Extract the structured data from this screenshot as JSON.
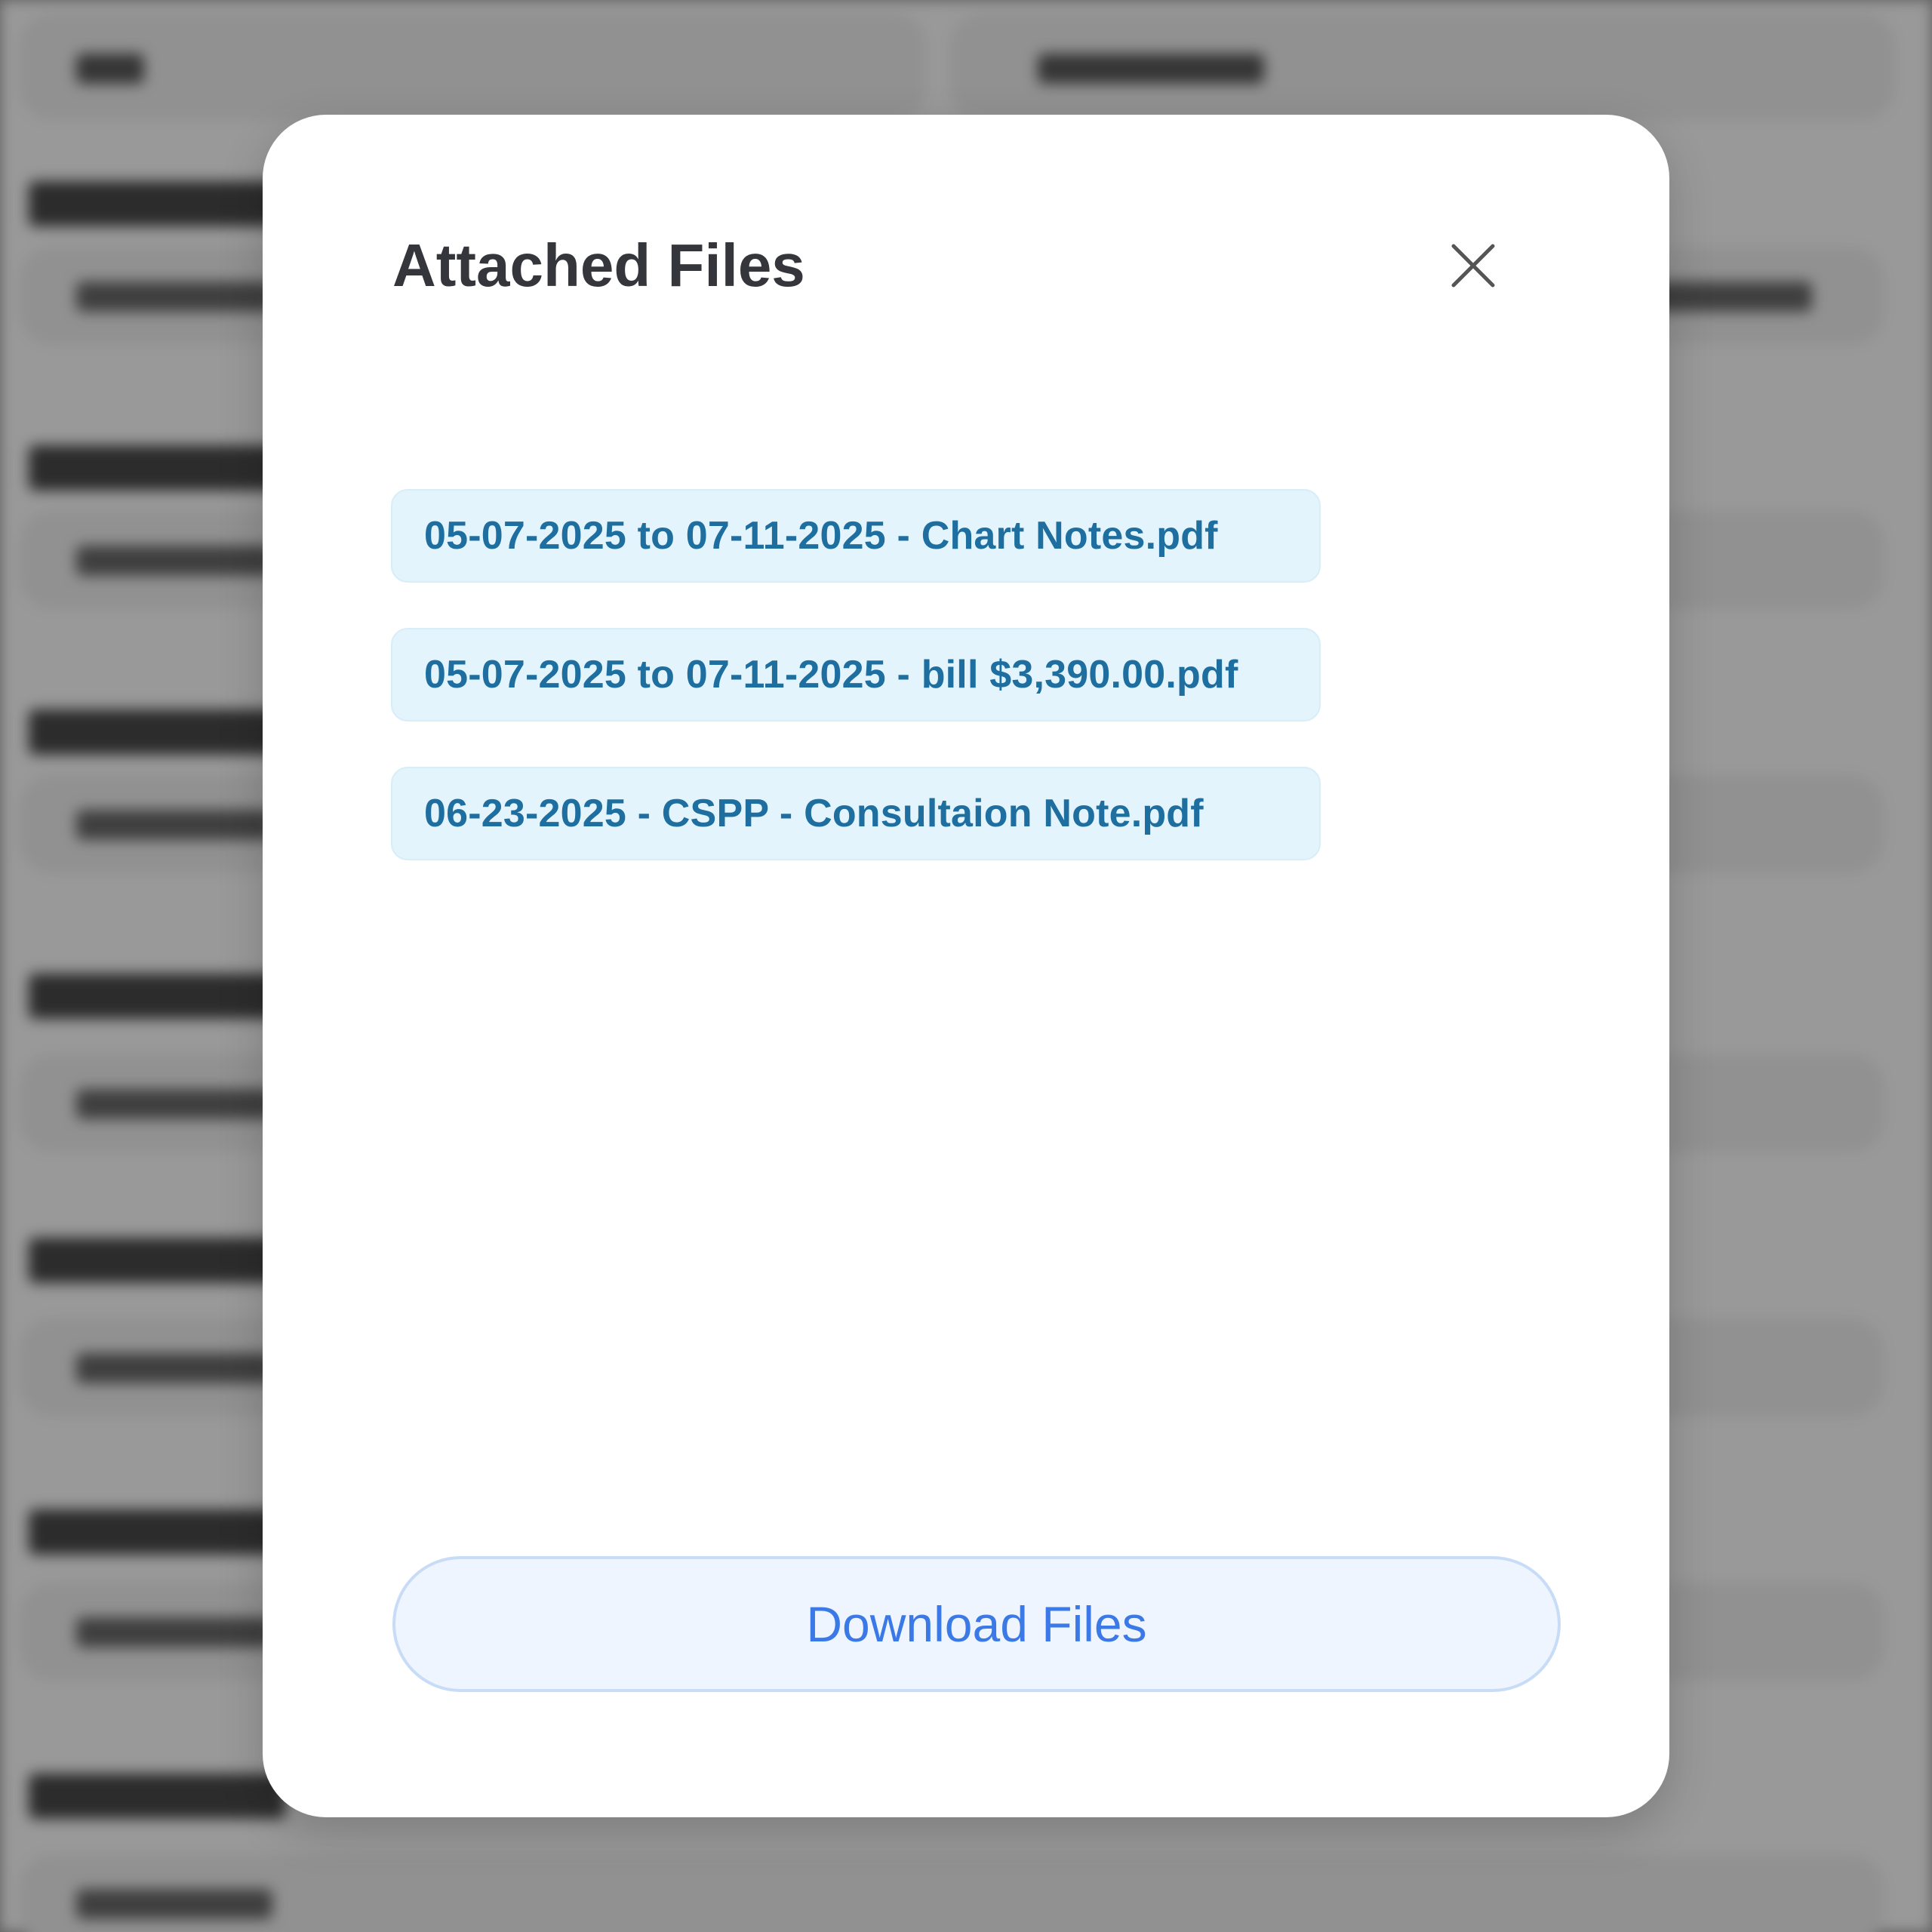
{
  "modal": {
    "title": "Attached Files",
    "close_icon": "close-icon",
    "files": [
      {
        "name": "05-07-2025 to 07-11-2025 -  Chart Notes.pdf"
      },
      {
        "name": "05-07-2025 to 07-11-2025 -  bill $3,390.00.pdf"
      },
      {
        "name": "06-23-2025 - CSPP - Consultaion Note.pdf"
      }
    ],
    "download_label": "Download Files"
  },
  "colors": {
    "title": "#35363b",
    "file_chip_bg": "#e3f4fc",
    "file_text": "#1e6fa0",
    "download_bg": "#eef5fe",
    "download_border": "#c8dcf7",
    "download_text": "#3b7ae6",
    "scrim": "rgba(0,0,0,0.4)"
  }
}
